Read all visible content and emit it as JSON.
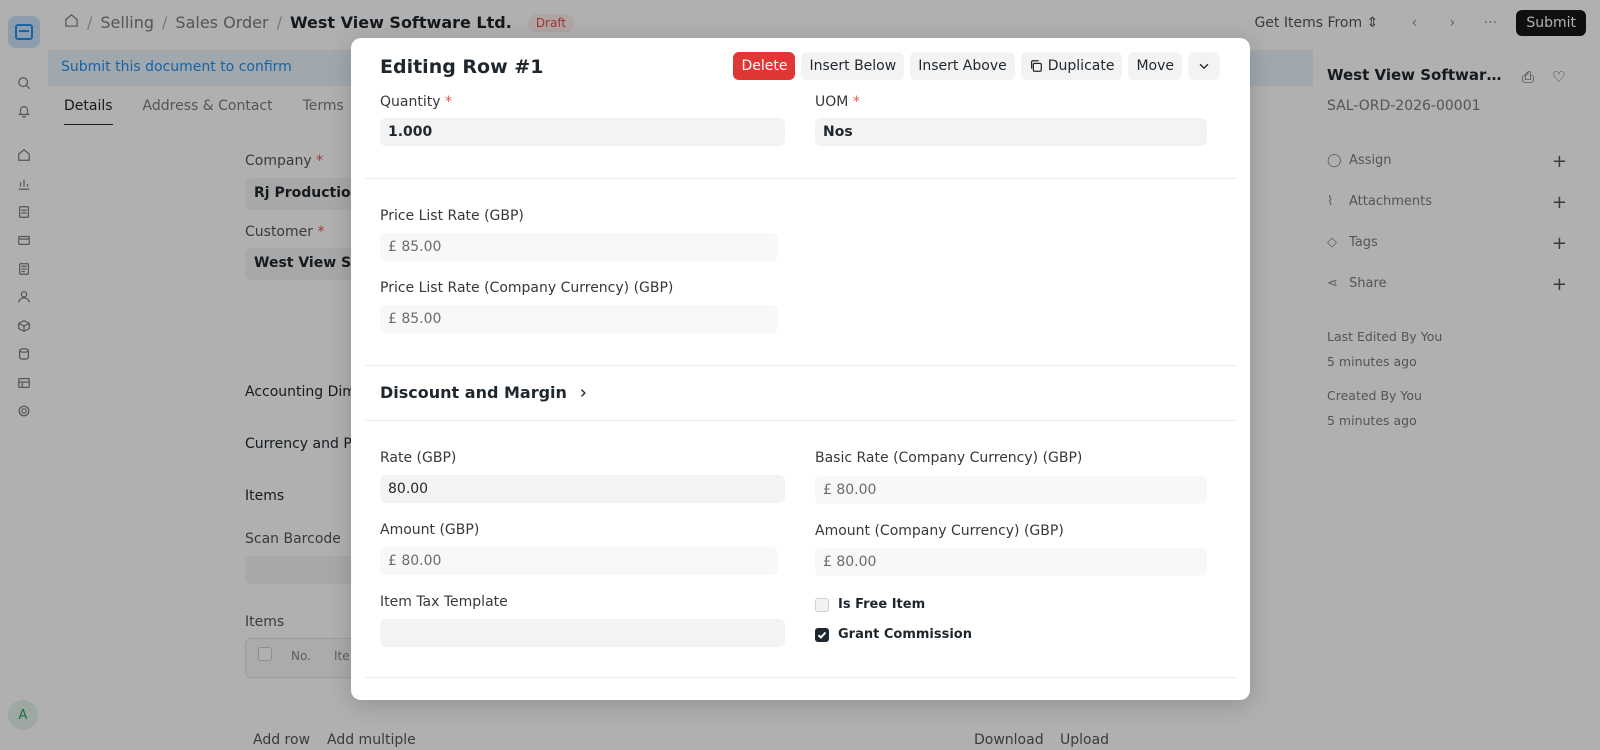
{
  "background": {
    "breadcrumb": [
      "Selling",
      "Sales Order",
      "West View Software Ltd."
    ],
    "status_badge": "Draft",
    "get_items_label": "Get Items From",
    "submit_label": "Submit",
    "notice": "Submit this document to confirm",
    "tabs": [
      "Details",
      "Address & Contact",
      "Terms"
    ],
    "company_label": "Company",
    "company_value": "Rj Production",
    "customer_label": "Customer",
    "customer_value": "West View So",
    "section_accounting": "Accounting Dim",
    "section_currency": "Currency and P",
    "section_items": "Items",
    "scan_barcode_label": "Scan Barcode",
    "items_table_label": "Items",
    "items_table_cols": [
      "No.",
      "Ite"
    ],
    "add_row_label": "Add row",
    "add_multiple_label": "Add multiple",
    "download_label": "Download",
    "upload_label": "Upload",
    "avatar_letter": "A"
  },
  "sidebar_right": {
    "doc_title": "West View Software Lt...",
    "doc_id": "SAL-ORD-2026-00001",
    "actions": [
      {
        "label": "Assign",
        "icon": "user-icon"
      },
      {
        "label": "Attachments",
        "icon": "paperclip-icon"
      },
      {
        "label": "Tags",
        "icon": "tag-icon"
      },
      {
        "label": "Share",
        "icon": "share-icon"
      }
    ],
    "last_edited": "Last Edited By You",
    "last_edited_time": "5 minutes ago",
    "created": "Created By You",
    "created_time": "5 minutes ago"
  },
  "modal": {
    "title": "Editing Row #1",
    "buttons": {
      "delete": "Delete",
      "insert_below": "Insert Below",
      "insert_above": "Insert Above",
      "duplicate": "Duplicate",
      "move": "Move"
    },
    "quantity": {
      "label": "Quantity",
      "value": "1.000"
    },
    "uom": {
      "label": "UOM",
      "value": "Nos"
    },
    "price_list_rate": {
      "label": "Price List Rate (GBP)",
      "value": "£ 85.00"
    },
    "price_list_rate_company": {
      "label": "Price List Rate (Company Currency) (GBP)",
      "value": "£ 85.00"
    },
    "discount_section": "Discount and Margin",
    "rate": {
      "label": "Rate (GBP)",
      "value": "80.00"
    },
    "basic_rate_company": {
      "label": "Basic Rate (Company Currency) (GBP)",
      "value": "£ 80.00"
    },
    "amount": {
      "label": "Amount (GBP)",
      "value": "£ 80.00"
    },
    "amount_company": {
      "label": "Amount (Company Currency) (GBP)",
      "value": "£ 80.00"
    },
    "item_tax_template": {
      "label": "Item Tax Template",
      "value": ""
    },
    "is_free_item": {
      "label": "Is Free Item",
      "checked": false
    },
    "grant_commission": {
      "label": "Grant Commission",
      "checked": true
    }
  },
  "colors": {
    "danger": "#e03636",
    "required": "#e2514a",
    "primary": "#2490ef"
  }
}
